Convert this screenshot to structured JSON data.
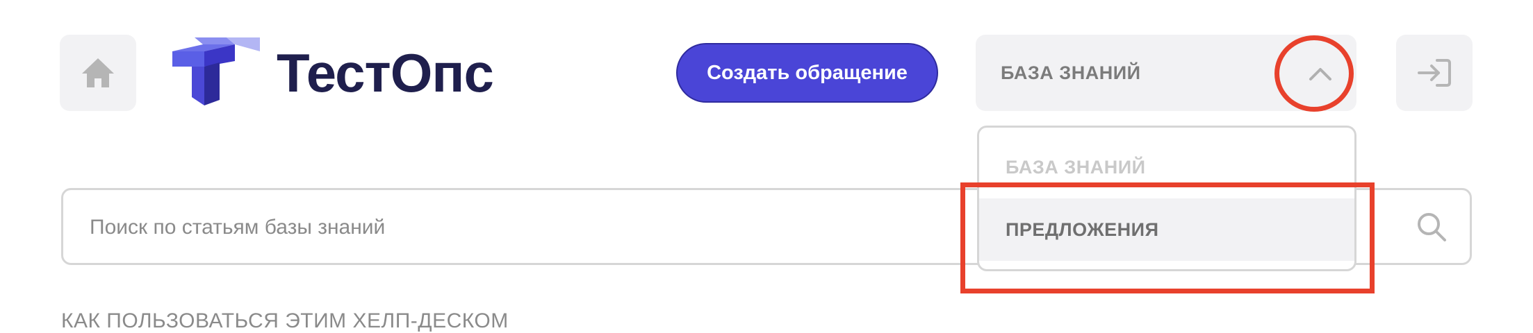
{
  "header": {
    "logo_text": "ТестОпс",
    "create_button_label": "Создать обращение",
    "knowledge_select": {
      "selected_label": "БАЗА ЗНАНИЙ",
      "options": [
        "БАЗА ЗНАНИЙ",
        "ПРЕДЛОЖЕНИЯ"
      ]
    }
  },
  "search": {
    "placeholder": "Поиск по статьям базы знаний"
  },
  "content": {
    "section_link": "КАК ПОЛЬЗОВАТЬСЯ ЭТИМ ХЕЛП-ДЕСКОМ"
  },
  "colors": {
    "accent": "#4a45d7",
    "annotation": "#e8412c",
    "logo_text": "#1f1f4d"
  },
  "icons": [
    "home-icon",
    "chevron-up-icon",
    "login-icon",
    "search-icon",
    "logo-mark-icon"
  ]
}
